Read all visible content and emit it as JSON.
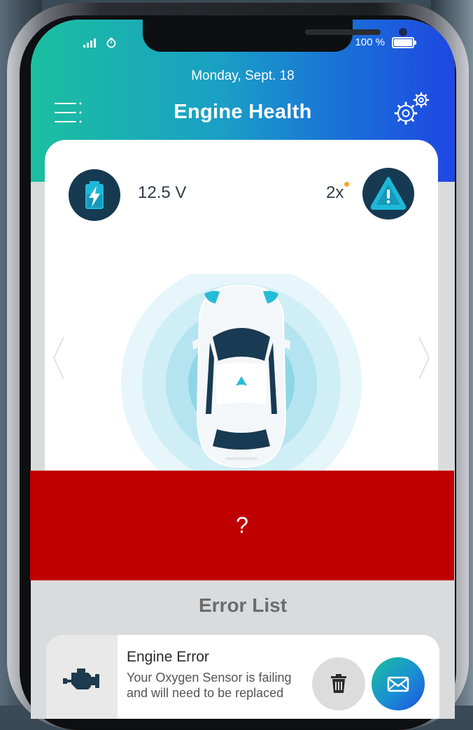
{
  "status_bar": {
    "battery_percent": "100 %"
  },
  "header": {
    "date": "Monday, Sept. 18",
    "title": "Engine Health"
  },
  "vehicle_card": {
    "voltage": "12.5 V",
    "alert_count": "2x"
  },
  "redaction": {
    "label": "?"
  },
  "error_list": {
    "title": "Error List",
    "items": [
      {
        "title": "Engine Error",
        "message": "Your Oxygen Sensor is failing and will need to be replaced"
      }
    ]
  },
  "colors": {
    "gradient_start": "#1bbf9f",
    "gradient_end": "#1f47e2",
    "icon_navy": "#153a52",
    "accent_cyan": "#1fb8d8",
    "redaction_red": "#bf0000",
    "alert_dot": "#f5a623"
  },
  "icons": [
    "signal-icon",
    "timer-icon",
    "battery-icon",
    "menu-icon",
    "settings-gears-icon",
    "battery-charge-icon",
    "warning-icon",
    "car-icon",
    "chevron-left-icon",
    "chevron-right-icon",
    "engine-icon",
    "trash-icon",
    "mail-icon"
  ]
}
